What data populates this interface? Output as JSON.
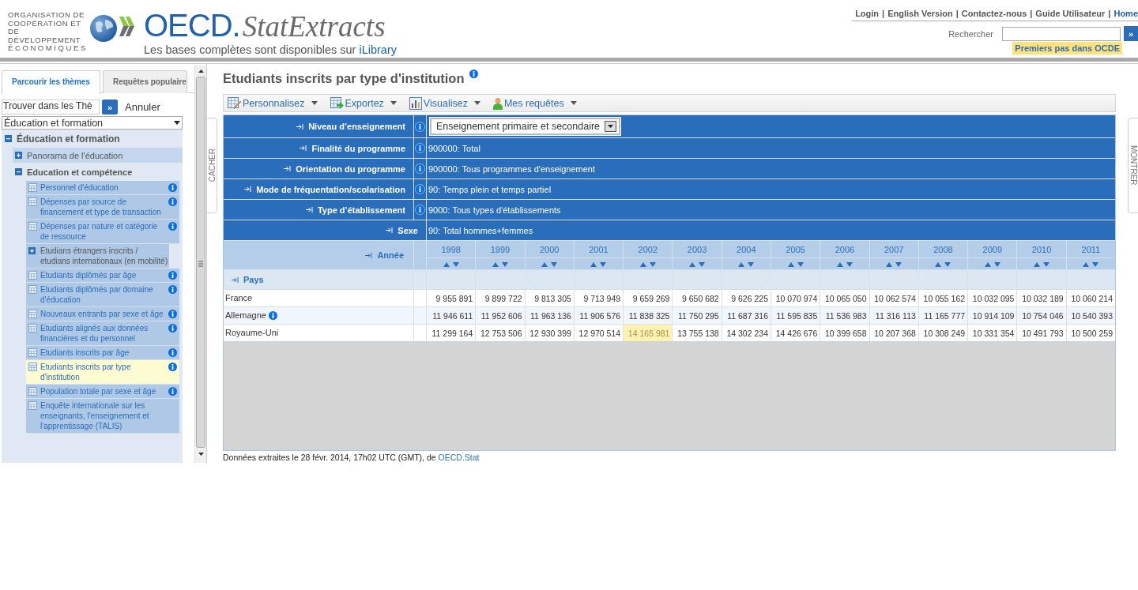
{
  "header": {
    "org_name": [
      "ORGANISATION DE",
      "COOPÉRATION ET",
      "DE DÉVELOPPEMENT",
      "ÉCONOMIQUES"
    ],
    "logo_main": "OECD.",
    "logo_product": "StatExtracts",
    "tagline": "Les bases complètes sont disponibles sur",
    "tagline_link": "iLibrary",
    "top_links": [
      {
        "label": "Login",
        "kind": "link"
      },
      {
        "label": "English Version",
        "kind": "link"
      },
      {
        "label": "Contactez-nous",
        "kind": "link"
      },
      {
        "label": "Guide Utilisateur",
        "kind": "link"
      },
      {
        "label": "Home",
        "kind": "home"
      }
    ],
    "separator": "|",
    "search_label": "Rechercher",
    "search_button": "»",
    "highlight_link": "Premiers pas dans OCDE"
  },
  "sidebar": {
    "tabs": [
      {
        "label": "Parcourir les thèmes",
        "selected": true
      },
      {
        "label": "Requêtes populaire",
        "selected": false
      }
    ],
    "find_value": "Trouver dans les Thè",
    "find_button": "»",
    "cancel": "Annuler",
    "theme_select": "Éducation et formation",
    "tree": [
      {
        "label": "Éducation et formation",
        "kind": "folder",
        "expanded": true,
        "children": [
          {
            "label": "Panorama de l'éducation",
            "kind": "folder",
            "expanded": false
          },
          {
            "label": "Education et compétence",
            "kind": "folder",
            "expanded": true,
            "children": [
              {
                "label": "Personnel d'éducation",
                "kind": "dataset",
                "info": true,
                "selected": false
              },
              {
                "label": "Dépenses par source de financement et type de transaction",
                "kind": "dataset",
                "info": true,
                "selected": false
              },
              {
                "label": "Dépenses par nature et catégorie de ressource",
                "kind": "dataset",
                "info": true,
                "selected": false
              },
              {
                "label": "Etudians étrangers inscrits / etudians internationaux (en mobilité)",
                "kind": "folder",
                "expanded": false
              },
              {
                "label": "Etudiants diplômés par âge",
                "kind": "dataset",
                "info": true,
                "selected": false
              },
              {
                "label": "Etudiants diplômés par domaine d'éducation",
                "kind": "dataset",
                "info": true,
                "selected": false
              },
              {
                "label": "Nouveaux entrants par sexe et âge",
                "kind": "dataset",
                "info": true,
                "selected": false
              },
              {
                "label": "Etudiants alignés aux données financières et du personnel",
                "kind": "dataset",
                "info": true,
                "selected": false
              },
              {
                "label": "Etudiants inscrits par âge",
                "kind": "dataset",
                "info": true,
                "selected": false
              },
              {
                "label": "Etudiants inscrits par type d'institution",
                "kind": "dataset",
                "info": true,
                "selected": true
              },
              {
                "label": "Population totale par sexe et âge",
                "kind": "dataset",
                "info": true,
                "selected": false
              },
              {
                "label": "Enquête internationale sur les enseignants, l'enseignement et l'apprentissage (TALIS)",
                "kind": "dataset",
                "info": false,
                "selected": false
              }
            ]
          }
        ]
      }
    ]
  },
  "main": {
    "hide_tab": "CACHER",
    "show_tab": "MONTRER",
    "title": "Etudiants inscrits par type d'institution",
    "toolbar": [
      {
        "label": "Personnalisez",
        "kind": "customize"
      },
      {
        "label": "Exportez",
        "kind": "export"
      },
      {
        "label": "Visualisez",
        "kind": "visualize"
      },
      {
        "label": "Mes requêtes",
        "kind": "queries"
      }
    ],
    "filters": [
      {
        "label": "Niveau d’enseignement",
        "value": "Enseignement primaire et secondaire",
        "kind": "select",
        "info": true
      },
      {
        "label": "Finalité du programme",
        "value": "900000: Total",
        "kind": "text",
        "info": true
      },
      {
        "label": "Orientation du programme",
        "value": "900000: Tous programmes d'enseignement",
        "kind": "text",
        "info": true
      },
      {
        "label": "Mode de fréquentation/scolarisation",
        "value": "90: Temps plein et temps partiel",
        "kind": "text",
        "info": true
      },
      {
        "label": "Type d’établissement",
        "value": "9000: Tous types d'établissements",
        "kind": "text",
        "info": true
      },
      {
        "label": "Sexe",
        "value": "90: Total hommes+femmes",
        "kind": "text",
        "info": false
      }
    ],
    "year_label": "Année",
    "years": [
      "1998",
      "1999",
      "2000",
      "2001",
      "2002",
      "2003",
      "2004",
      "2005",
      "2006",
      "2007",
      "2008",
      "2009",
      "2010",
      "2011"
    ],
    "row_label": "Pays",
    "rows": [
      {
        "country": "France",
        "info": false,
        "cells": [
          {
            "v": "9 955 891",
            "selected": false
          },
          {
            "v": "9 899 722",
            "selected": false
          },
          {
            "v": "9 813 305",
            "selected": false
          },
          {
            "v": "9 713 949",
            "selected": false
          },
          {
            "v": "9 659 269",
            "selected": false
          },
          {
            "v": "9 650 682",
            "selected": false
          },
          {
            "v": "9 626 225",
            "selected": false
          },
          {
            "v": "10 070 974",
            "selected": false
          },
          {
            "v": "10 065 050",
            "selected": false
          },
          {
            "v": "10 062 574",
            "selected": false
          },
          {
            "v": "10 055 162",
            "selected": false
          },
          {
            "v": "10 032 095",
            "selected": false
          },
          {
            "v": "10 032 189",
            "selected": false
          },
          {
            "v": "10 060 214",
            "selected": false
          }
        ]
      },
      {
        "country": "Allemagne",
        "info": true,
        "cells": [
          {
            "v": "11 946 611",
            "selected": false
          },
          {
            "v": "11 952 606",
            "selected": false
          },
          {
            "v": "11 963 136",
            "selected": false
          },
          {
            "v": "11 906 576",
            "selected": false
          },
          {
            "v": "11 838 325",
            "selected": false
          },
          {
            "v": "11 750 295",
            "selected": false
          },
          {
            "v": "11 687 316",
            "selected": false
          },
          {
            "v": "11 595 835",
            "selected": false
          },
          {
            "v": "11 536 983",
            "selected": false
          },
          {
            "v": "11 316 113",
            "selected": false
          },
          {
            "v": "11 165 777",
            "selected": false
          },
          {
            "v": "10 914 109",
            "selected": false
          },
          {
            "v": "10 754 046",
            "selected": false
          },
          {
            "v": "10 540 393",
            "selected": false
          }
        ]
      },
      {
        "country": "Royaume-Uni",
        "info": false,
        "cells": [
          {
            "v": "11 299 164",
            "selected": false
          },
          {
            "v": "12 753 506",
            "selected": false
          },
          {
            "v": "12 930 399",
            "selected": false
          },
          {
            "v": "12 970 514",
            "selected": false
          },
          {
            "v": "14 165 981",
            "selected": true
          },
          {
            "v": "13 755 138",
            "selected": false
          },
          {
            "v": "14 302 234",
            "selected": false
          },
          {
            "v": "14 426 676",
            "selected": false
          },
          {
            "v": "10 399 658",
            "selected": false
          },
          {
            "v": "10 207 368",
            "selected": false
          },
          {
            "v": "10 308 249",
            "selected": false
          },
          {
            "v": "10 331 354",
            "selected": false
          },
          {
            "v": "10 491 793",
            "selected": false
          },
          {
            "v": "10 500 259",
            "selected": false
          }
        ]
      }
    ],
    "footer_text": "Données extraites le 28 févr. 2014, 17h02 UTC (GMT), de",
    "footer_link": "OECD.Stat"
  }
}
